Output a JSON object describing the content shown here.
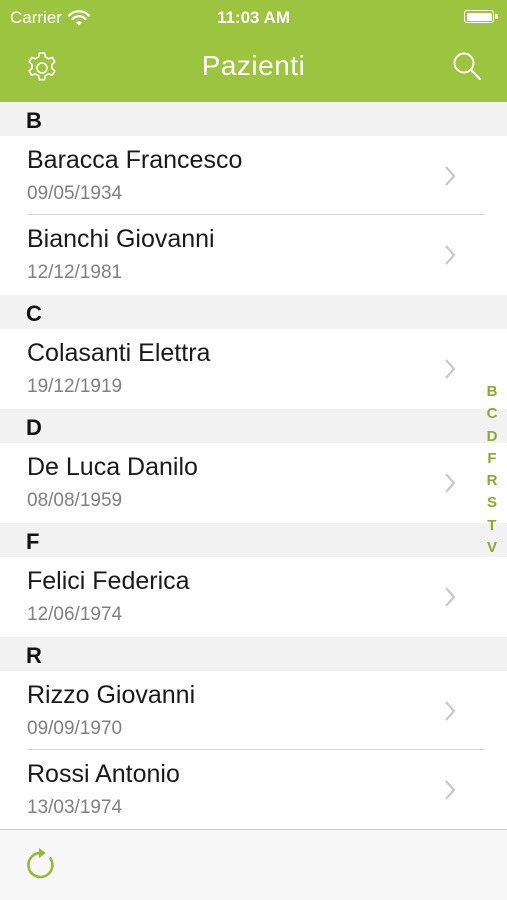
{
  "status_bar": {
    "carrier": "Carrier",
    "time": "11:03 AM",
    "battery_level": 1.0
  },
  "nav": {
    "title": "Pazienti",
    "settings_icon": "gear-icon",
    "search_icon": "search-icon"
  },
  "sections": [
    {
      "letter": "B",
      "patients": [
        {
          "name": "Baracca Francesco",
          "date": "09/05/1934"
        },
        {
          "name": "Bianchi Giovanni",
          "date": "12/12/1981"
        }
      ]
    },
    {
      "letter": "C",
      "patients": [
        {
          "name": "Colasanti Elettra",
          "date": "19/12/1919"
        }
      ]
    },
    {
      "letter": "D",
      "patients": [
        {
          "name": "De Luca Danilo",
          "date": "08/08/1959"
        }
      ]
    },
    {
      "letter": "F",
      "patients": [
        {
          "name": "Felici Federica",
          "date": "12/06/1974"
        }
      ]
    },
    {
      "letter": "R",
      "patients": [
        {
          "name": "Rizzo Giovanni",
          "date": "09/09/1970"
        },
        {
          "name": "Rossi Antonio",
          "date": "13/03/1974"
        }
      ]
    }
  ],
  "index_letters": [
    "B",
    "C",
    "D",
    "F",
    "R",
    "S",
    "T",
    "V"
  ],
  "toolbar": {
    "refresh_icon": "refresh-icon"
  },
  "colors": {
    "accent": "#9cc43f",
    "index": "#8aaa2f"
  }
}
